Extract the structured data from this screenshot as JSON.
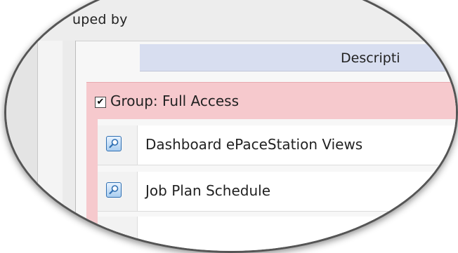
{
  "header": {
    "grouped_by_label": "uped by"
  },
  "table": {
    "column_header": "Descripti",
    "group": {
      "checked": true,
      "check_glyph": "✔",
      "label": "Group: Full Access"
    },
    "items": [
      {
        "icon": "magnifier-icon",
        "label": "Dashboard ePaceStation Views"
      },
      {
        "icon": "magnifier-icon",
        "label": "Job Plan Schedule"
      }
    ]
  },
  "colors": {
    "group_row": "#f6c9cd",
    "column_header": "#d8def0",
    "icon_border": "#2f6fb2"
  }
}
